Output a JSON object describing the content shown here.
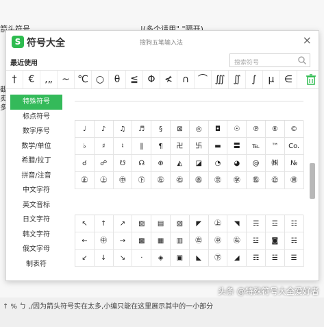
{
  "background": {
    "row1_left": "箭头符号",
    "row1_right": "|(多个请用\",\"隔开)",
    "left_fragment": "截 卖 多",
    "bottom_text": "↑ % ㄅ ,/因为箭头符号实在太多,小编只能在这里展示其中的一小部分"
  },
  "panel": {
    "logo_letter": "S",
    "title": "符号大全",
    "ime_hint": "搜狗五笔输入法",
    "close": "×",
    "recent_label": "最近使用",
    "search_placeholder": "搜索符号",
    "recent": [
      "†",
      "€",
      "‚„",
      "~",
      "℃",
      "○",
      "θ",
      "≦",
      "Φ",
      "≮",
      "∩",
      "⌒",
      "∭",
      "∬",
      "∫",
      "μ",
      "∈"
    ],
    "sidebar": [
      "特殊符号",
      "标点符号",
      "数字序号",
      "数学/单位",
      "希腊/拉丁",
      "拼音/注音",
      "中文字符",
      "英文音标",
      "日文字符",
      "韩文字符",
      "俄文字母",
      "制表符"
    ],
    "grid1": [
      [
        "♩",
        "♪",
        "♫",
        "♬",
        "§",
        "⊠",
        "◎",
        "◘",
        "☉",
        "℗",
        "®",
        "©"
      ],
      [
        "♭",
        "♯",
        "♮",
        "‖",
        "¶",
        "卍",
        "卐",
        "▬",
        "〓",
        "℡",
        "™",
        "Co."
      ],
      [
        "☌",
        "☍",
        "☋",
        "☊",
        "⊕",
        "◭",
        "◪",
        "◔",
        "◕",
        "@",
        "㈱",
        "№"
      ],
      [
        "㊣",
        "㊤",
        "㊥",
        "㊦",
        "㊧",
        "㊨",
        "㊩",
        "㊪",
        "㊫",
        "㊬",
        "㊭",
        "㊮"
      ]
    ],
    "grid2": [
      [
        "↖",
        "↑",
        "↗",
        "▨",
        "▤",
        "▧",
        "◤",
        "㊤",
        "◥",
        "☴",
        "☲",
        "☷"
      ],
      [
        "←",
        "㊥",
        "→",
        "▩",
        "▦",
        "▥",
        "㊧",
        "㊥",
        "㊨",
        "☳",
        "◙",
        "☵"
      ],
      [
        "↙",
        "↓",
        "↘",
        "·",
        "◈",
        "▣",
        "◣",
        "㊦",
        "◢",
        "☶",
        "☱",
        "☰"
      ]
    ]
  },
  "watermark": "头条 @特殊符号大全爱好者"
}
